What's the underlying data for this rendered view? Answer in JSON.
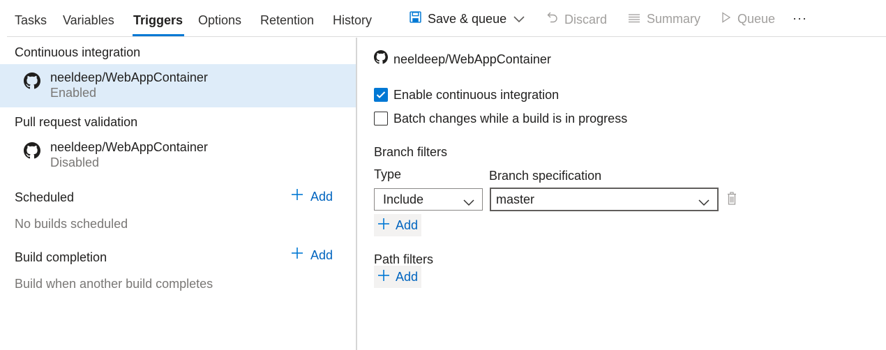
{
  "tabs": [
    {
      "label": "Tasks"
    },
    {
      "label": "Variables"
    },
    {
      "label": "Triggers"
    },
    {
      "label": "Options"
    },
    {
      "label": "Retention"
    },
    {
      "label": "History"
    }
  ],
  "toolbar": {
    "save_queue": "Save & queue",
    "discard": "Discard",
    "summary": "Summary",
    "queue": "Queue",
    "more": "···"
  },
  "left": {
    "ci_title": "Continuous integration",
    "ci_repo": {
      "name": "neeldeep/WebAppContainer",
      "status": "Enabled"
    },
    "pr_title": "Pull request validation",
    "pr_repo": {
      "name": "neeldeep/WebAppContainer",
      "status": "Disabled"
    },
    "scheduled_title": "Scheduled",
    "scheduled_add": "Add",
    "scheduled_empty": "No builds scheduled",
    "completion_title": "Build completion",
    "completion_add": "Add",
    "completion_empty": "Build when another build completes"
  },
  "right": {
    "repo_name": "neeldeep/WebAppContainer",
    "enable_ci_label": "Enable continuous integration",
    "enable_ci_checked": true,
    "batch_label": "Batch changes while a build is in progress",
    "batch_checked": false,
    "branch_filters_title": "Branch filters",
    "type_label": "Type",
    "branch_spec_label": "Branch specification",
    "type_value": "Include",
    "branch_value": "master",
    "branch_add": "Add",
    "path_filters_title": "Path filters",
    "path_add": "Add"
  },
  "colors": {
    "accent": "#0078d4",
    "link": "#0064bf",
    "selected_bg": "#deecf9",
    "muted_text": "#797775"
  }
}
